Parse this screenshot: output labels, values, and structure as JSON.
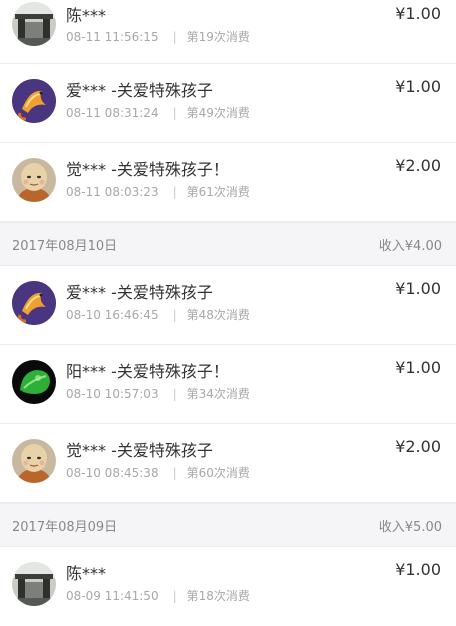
{
  "currency_symbol": "¥",
  "groups": [
    {
      "date": "",
      "income": "",
      "records": [
        {
          "name": "陈***",
          "time": "08-11 11:56:15",
          "count": "第19次消费",
          "amount": "¥1.00",
          "avatar": "gate-photo-avatar"
        }
      ]
    },
    {
      "date": "",
      "income": "",
      "records": [
        {
          "name": "爱*** -关爱特殊孩子",
          "time": "08-11 08:31:24",
          "count": "第49次消费",
          "amount": "¥1.00",
          "avatar": "koi-fish-avatar"
        },
        {
          "name": "觉*** -关爱特殊孩子！",
          "time": "08-11 08:03:23",
          "count": "第61次消费",
          "amount": "¥2.00",
          "avatar": "monk-doll-avatar"
        }
      ]
    },
    {
      "date": "2017年08月10日",
      "income": "收入¥4.00",
      "records": [
        {
          "name": "爱*** -关爱特殊孩子",
          "time": "08-10 16:46:45",
          "count": "第48次消费",
          "amount": "¥1.00",
          "avatar": "koi-fish-avatar"
        },
        {
          "name": "阳*** -关爱特殊孩子！",
          "time": "08-10 10:57:03",
          "count": "第34次消费",
          "amount": "¥1.00",
          "avatar": "green-leaf-avatar"
        },
        {
          "name": "觉*** -关爱特殊孩子",
          "time": "08-10 08:45:38",
          "count": "第60次消费",
          "amount": "¥2.00",
          "avatar": "monk-doll-avatar"
        }
      ]
    },
    {
      "date": "2017年08月09日",
      "income": "收入¥5.00",
      "records": [
        {
          "name": "陈***",
          "time": "08-09 11:41:50",
          "count": "第18次消费",
          "amount": "¥1.00",
          "avatar": "gate-photo-avatar"
        }
      ]
    }
  ],
  "colors": {
    "text": "#333333",
    "meta": "#a8a8a8",
    "header_bg": "#f5f5f7",
    "divider": "#ededed"
  }
}
